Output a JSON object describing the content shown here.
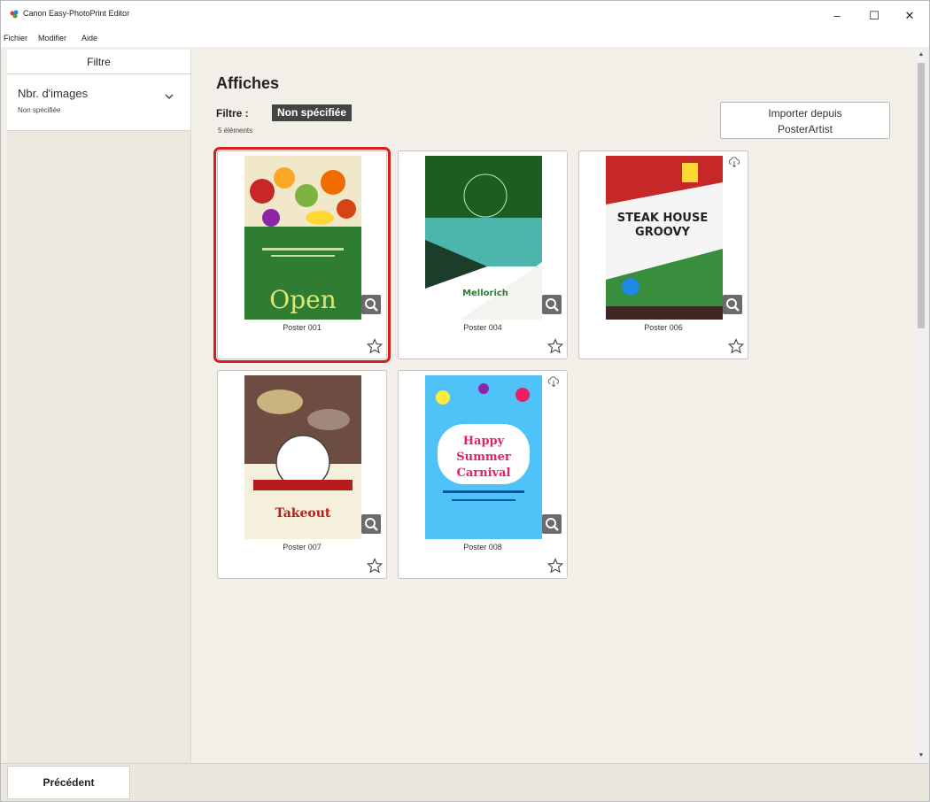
{
  "window": {
    "title": "Canon Easy-PhotoPrint Editor",
    "controls": {
      "minimize": "–",
      "maximize": "☐",
      "close": "✕"
    }
  },
  "menu": {
    "items": [
      "Fichier",
      "Modifier",
      "Aide"
    ]
  },
  "sidebar": {
    "header": "Filtre",
    "filter": {
      "label": "Nbr. d'images",
      "value": "Non spécifiée"
    }
  },
  "main": {
    "title": "Affiches",
    "filter_label": "Filtre :",
    "filter_chip": "Non spécifiée",
    "count": "5 éléments",
    "import_button": {
      "line1": "Importer depuis",
      "line2": "PosterArtist"
    }
  },
  "posters": [
    {
      "name": "Poster 001",
      "selected": true,
      "cloud": false,
      "thumb_colors": [
        "#2e7d32",
        "#c62828",
        "#f9a825"
      ],
      "thumb_text": "Open"
    },
    {
      "name": "Poster 004",
      "selected": false,
      "cloud": false,
      "thumb_colors": [
        "#1b5e20",
        "#4db6ac",
        "#ffffff"
      ],
      "thumb_text": "Mellorich"
    },
    {
      "name": "Poster 006",
      "selected": false,
      "cloud": true,
      "thumb_colors": [
        "#c62828",
        "#ffffff",
        "#388e3c"
      ],
      "thumb_text": "STEAK HOUSE GROOVY"
    },
    {
      "name": "Poster 007",
      "selected": false,
      "cloud": false,
      "thumb_colors": [
        "#6d4c41",
        "#f5f0dc",
        "#b71c1c"
      ],
      "thumb_text": "Takeout"
    },
    {
      "name": "Poster 008",
      "selected": false,
      "cloud": true,
      "thumb_colors": [
        "#4fc3f7",
        "#e91e63",
        "#ffeb3b"
      ],
      "thumb_text": "Happy Summer Carnival"
    }
  ],
  "bottom": {
    "previous_button": "Précédent"
  },
  "colors": {
    "selection": "#d81c20",
    "chip_bg": "#444444",
    "zoom_bg": "#6b6b6b"
  }
}
